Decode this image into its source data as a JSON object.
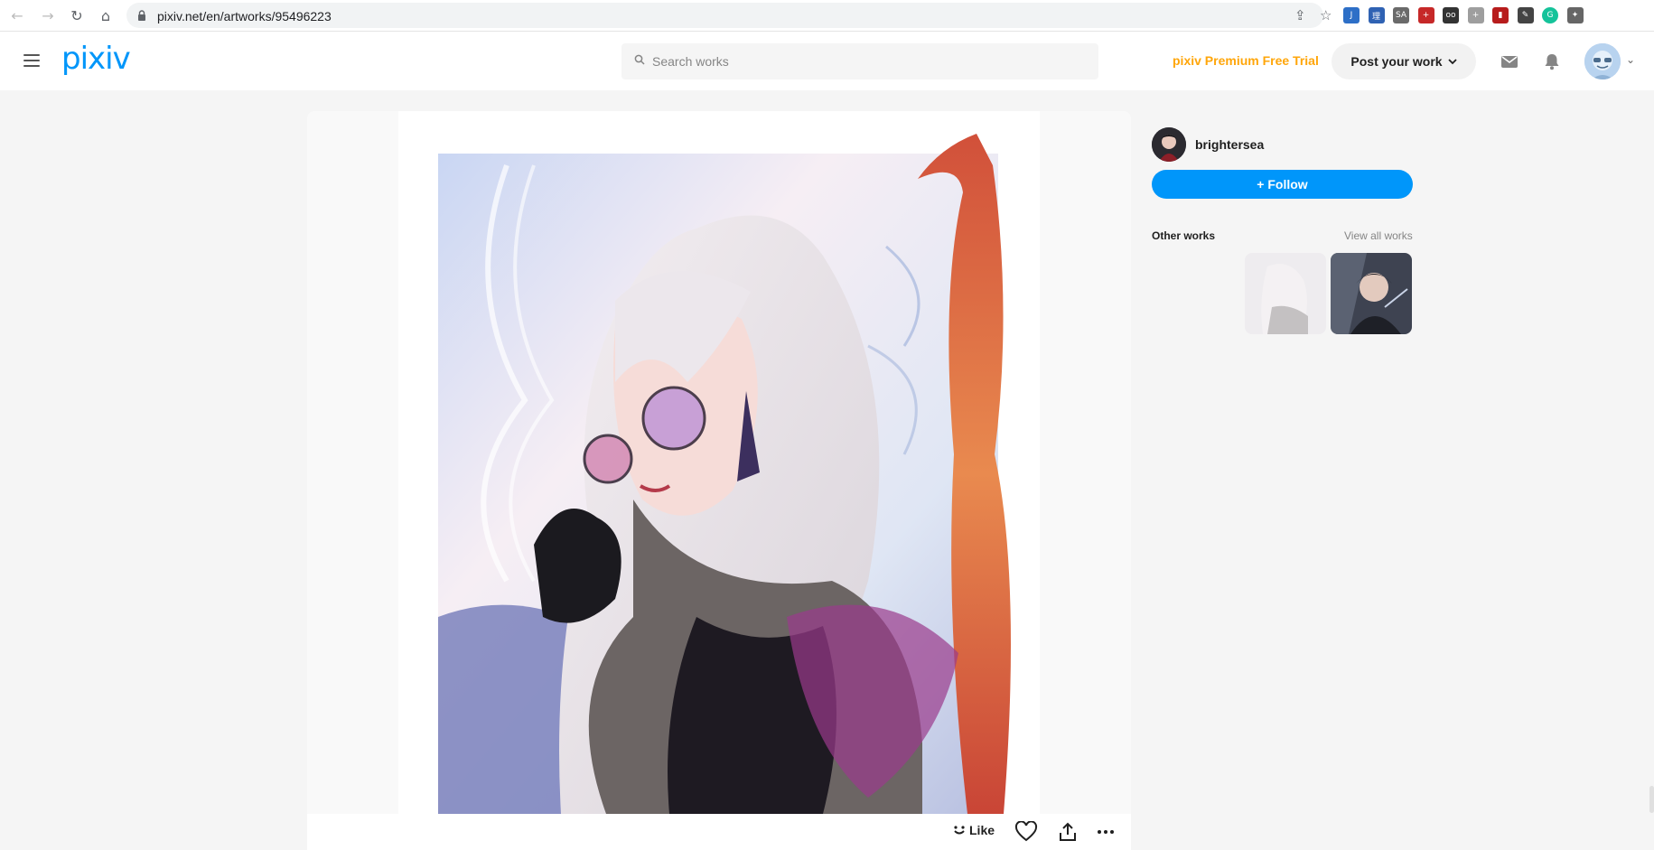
{
  "browser": {
    "url": "pixiv.net/en/artworks/95496223",
    "nav_icons": [
      "back-arrow-icon",
      "forward-arrow-icon",
      "reload-icon",
      "home-icon"
    ],
    "extensions": [
      {
        "name": "ext-1-icon",
        "color": "#2d6fc7",
        "glyph": "J"
      },
      {
        "name": "ext-2-icon",
        "color": "#2f62b3",
        "glyph": "理"
      },
      {
        "name": "ext-3-icon",
        "color": "#6a6a6a",
        "glyph": "SA"
      },
      {
        "name": "ext-4-icon",
        "color": "#c62828",
        "glyph": "+"
      },
      {
        "name": "ext-5-icon",
        "color": "#333333",
        "glyph": "oo"
      },
      {
        "name": "ext-6-icon",
        "color": "#9e9e9e",
        "glyph": "+"
      },
      {
        "name": "ext-7-icon",
        "color": "#b71c1c",
        "glyph": "▮"
      },
      {
        "name": "ext-8-icon",
        "color": "#444444",
        "glyph": "✎"
      },
      {
        "name": "ext-9-icon",
        "color": "#15c39a",
        "glyph": "G"
      },
      {
        "name": "ext-10-icon",
        "color": "#666666",
        "glyph": "✦"
      }
    ]
  },
  "header": {
    "logo_text": "pixiv",
    "search_placeholder": "Search works",
    "premium_label": "pixiv Premium Free Trial",
    "post_label": "Post your work"
  },
  "artwork": {
    "like_label": "Like"
  },
  "author": {
    "name": "brightersea",
    "follow_label": "+ Follow"
  },
  "other_works": {
    "title": "Other works",
    "view_all_label": "View all works"
  },
  "colors": {
    "brand": "#0096fa",
    "premium": "#ffa60a"
  }
}
